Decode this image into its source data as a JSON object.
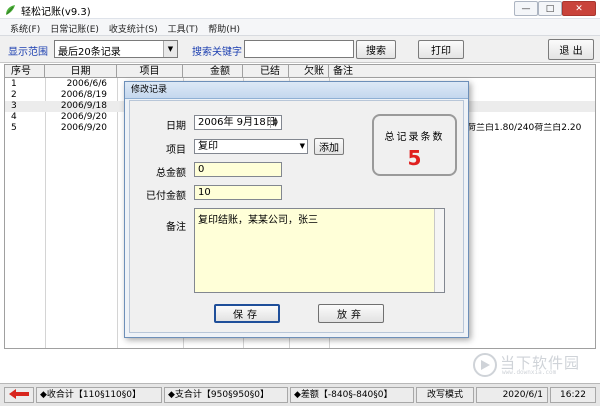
{
  "window": {
    "title": "轻松记账(v9.3)",
    "min_glyph": "—",
    "max_glyph": "□",
    "close_glyph": "✕"
  },
  "menu": [
    "系统(F)",
    "日常记账(E)",
    "收支统计(S)",
    "工具(T)",
    "帮助(H)"
  ],
  "toolbar": {
    "range_label": "显示范围",
    "range_value": "最后20条记录",
    "search_label": "搜索关键字",
    "search_value": "",
    "search_button": "搜索",
    "print_button": "打印",
    "exit_button": "退 出"
  },
  "grid": {
    "headers": [
      "序号",
      "日期",
      "项目",
      "金额",
      "已结",
      "欠账",
      "备注"
    ],
    "rows": [
      {
        "no": "1",
        "date": "2006/6/6",
        "item": "",
        "amount": "",
        "paid": "",
        "owed": "",
        "memo": ""
      },
      {
        "no": "2",
        "date": "2006/8/19",
        "item": "",
        "amount": "",
        "paid": "",
        "owed": "",
        "memo": ""
      },
      {
        "no": "3",
        "date": "2006/9/18",
        "item": "",
        "amount": "",
        "paid": "",
        "owed": "",
        "memo": ""
      },
      {
        "no": "4",
        "date": "2006/9/20",
        "item": "",
        "amount": "",
        "paid": "",
        "owed": "",
        "memo": ""
      },
      {
        "no": "5",
        "date": "2006/9/20",
        "item": "",
        "amount": "",
        "paid": "",
        "owed": "",
        "memo": "荷兰白1.80/240荷兰白2.20"
      }
    ]
  },
  "dialog": {
    "title": "修改记录",
    "date_label": "日期",
    "date_value": "2006年 9月18日",
    "item_label": "项目",
    "item_value": "复印",
    "add_button": "添加",
    "total_label": "总金额",
    "total_value": "0",
    "paid_label": "已付金额",
    "paid_value": "10",
    "memo_label": "备注",
    "memo_value": "复印结账，某某公司，张三",
    "counter_label": "总记录条数",
    "counter_value": "5",
    "save_button": "保存",
    "cancel_button": "放弃"
  },
  "status": {
    "income": "◆收合计【110§110§0】",
    "expense": "◆支合计【950§950§0】",
    "balance": "◆差额【-840§-840§0】",
    "mode": "改写模式",
    "date": "2020/6/1",
    "time": "16:22"
  },
  "watermark": {
    "text": "当下软件园",
    "sub": "www.downxia.com"
  },
  "colors": {
    "accent_blue": "#1c3fb0",
    "counter_red": "#e0201f",
    "memo_yellow": "#ffffd8"
  }
}
